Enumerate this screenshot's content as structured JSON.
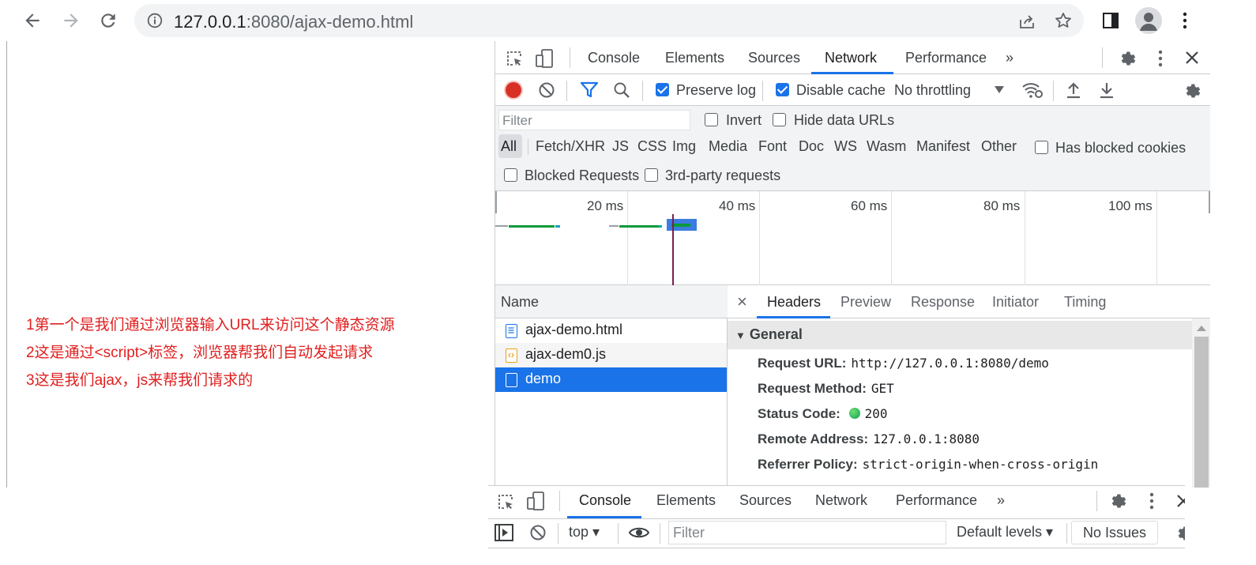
{
  "browser": {
    "url_host": "127.0.0.1",
    "url_rest": ":8080/ajax-demo.html"
  },
  "page": {
    "notes": [
      "1第一个是我们通过浏览器输入URL来访问这个静态资源",
      "2这是通过<script>标签，浏览器帮我们自动发起请求",
      "3这是我们ajax，js来帮我们请求的"
    ]
  },
  "devtools": {
    "tabs": [
      "Console",
      "Elements",
      "Sources",
      "Network",
      "Performance",
      "»"
    ],
    "active_tab": "Network",
    "toolbar": {
      "preserve_log": "Preserve log",
      "disable_cache": "Disable cache",
      "throttling": "No throttling"
    },
    "filter": {
      "placeholder": "Filter",
      "invert": "Invert",
      "hide_data_urls": "Hide data URLs",
      "types": [
        "All",
        "Fetch/XHR",
        "JS",
        "CSS",
        "Img",
        "Media",
        "Font",
        "Doc",
        "WS",
        "Wasm",
        "Manifest",
        "Other"
      ],
      "has_blocked_cookies": "Has blocked cookies",
      "blocked_requests": "Blocked Requests",
      "third_party": "3rd-party requests"
    },
    "overview": {
      "ticks": [
        "20 ms",
        "40 ms",
        "60 ms",
        "80 ms",
        "100 ms"
      ]
    },
    "requests": {
      "header": "Name",
      "rows": [
        {
          "name": "ajax-demo.html",
          "selected": false
        },
        {
          "name": "ajax-dem0.js",
          "selected": false
        },
        {
          "name": "demo",
          "selected": true
        }
      ]
    },
    "detail": {
      "close": "×",
      "tabs": [
        "Headers",
        "Preview",
        "Response",
        "Initiator",
        "Timing"
      ],
      "active_tab": "Headers",
      "section": "General",
      "fields": [
        {
          "key": "Request URL:",
          "value": "http://127.0.0.1:8080/demo"
        },
        {
          "key": "Request Method:",
          "value": "GET"
        },
        {
          "key": "Status Code:",
          "value": "200"
        },
        {
          "key": "Remote Address:",
          "value": "127.0.0.1:8080"
        },
        {
          "key": "Referrer Policy:",
          "value": "strict-origin-when-cross-origin"
        }
      ]
    }
  },
  "drawer": {
    "tabs": [
      "Console",
      "Elements",
      "Sources",
      "Network",
      "Performance",
      "»"
    ],
    "active_tab": "Console",
    "context": "top ▾",
    "filter_placeholder": "Filter",
    "levels": "Default levels ▾",
    "issues": "No Issues"
  },
  "colors": {
    "accent": "#1a73e8",
    "note_red": "#e02020",
    "status_green": "#0f9d58",
    "record_red": "#d93025"
  }
}
